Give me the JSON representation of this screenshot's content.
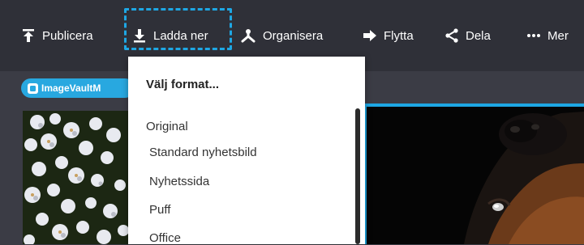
{
  "toolbar": {
    "items": [
      {
        "label": "Publicera",
        "icon": "publish-icon"
      },
      {
        "label": "Ladda ner",
        "icon": "download-icon"
      },
      {
        "label": "Organisera",
        "icon": "organize-icon"
      },
      {
        "label": "Flytta",
        "icon": "move-arrow-icon"
      },
      {
        "label": "Dela",
        "icon": "share-icon"
      },
      {
        "label": "Mer",
        "icon": "more-dots-icon"
      }
    ]
  },
  "chip": {
    "label": "ImageVaultM",
    "icon": "imagevault-icon"
  },
  "dropdown": {
    "header": "Välj format...",
    "items": [
      "Original",
      "Standard nyhetsbild",
      "Nyhetssida",
      "Puff",
      "Office"
    ]
  },
  "colors": {
    "toolbar_bg": "#2f3038",
    "content_bg": "#3b3c45",
    "accent": "#1ea7e4",
    "chip_bg": "#28a8e0"
  }
}
